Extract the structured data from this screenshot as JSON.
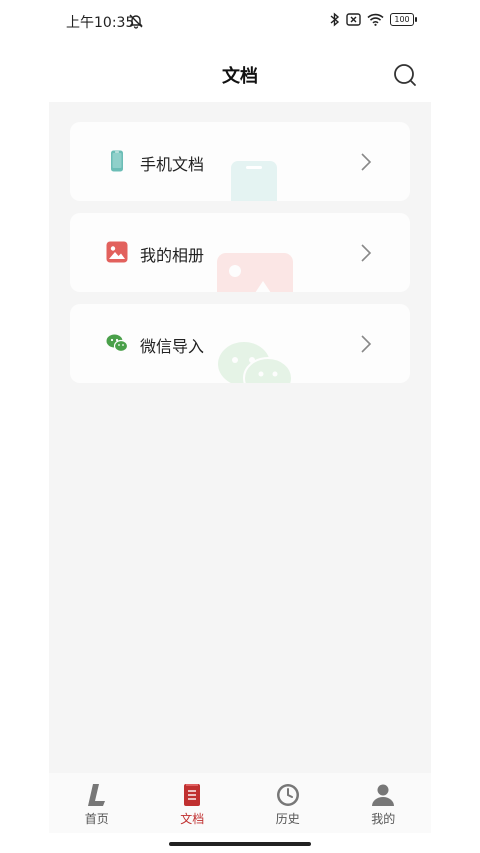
{
  "status": {
    "time": "上午10:35",
    "battery": "100"
  },
  "header": {
    "title": "文档"
  },
  "cards": [
    {
      "label": "手机文档",
      "icon": "phone-icon",
      "color": "#6bbdb6"
    },
    {
      "label": "我的相册",
      "icon": "picture-icon",
      "color": "#e2615d"
    },
    {
      "label": "微信导入",
      "icon": "wechat-icon",
      "color": "#4aa04a"
    }
  ],
  "tabbar": {
    "active_color": "#c03030",
    "tabs": [
      {
        "label": "首页",
        "icon": "home-logo-icon"
      },
      {
        "label": "文档",
        "icon": "document-icon",
        "active": true
      },
      {
        "label": "历史",
        "icon": "clock-icon"
      },
      {
        "label": "我的",
        "icon": "person-icon"
      }
    ]
  }
}
